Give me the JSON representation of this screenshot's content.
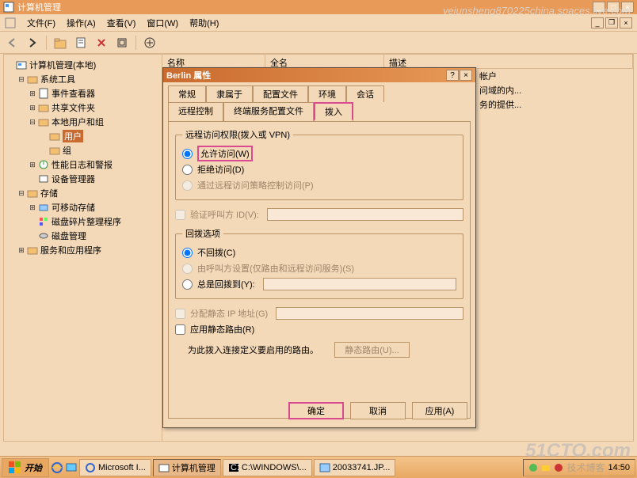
{
  "watermark1": "yejunsheng870225china.spaces.live.com",
  "watermark2": "51CTO.com",
  "watermark3": "技术博客",
  "window": {
    "title": "计算机管理"
  },
  "menu": {
    "file": "文件(F)",
    "action": "操作(A)",
    "view": "查看(V)",
    "window": "窗口(W)",
    "help": "帮助(H)"
  },
  "tree": {
    "root": "计算机管理(本地)",
    "system_tools": "系统工具",
    "event_viewer": "事件查看器",
    "shared_folders": "共享文件夹",
    "local_users": "本地用户和组",
    "users": "用户",
    "groups": "组",
    "perf": "性能日志和警报",
    "device_mgr": "设备管理器",
    "storage": "存储",
    "removable": "可移动存储",
    "defrag": "磁盘碎片整理程序",
    "disk_mgmt": "磁盘管理",
    "services": "服务和应用程序"
  },
  "list": {
    "col_name": "名称",
    "col_full": "全名",
    "col_desc": "描述",
    "row1_desc": "帐户",
    "row2_desc": "问域的内...",
    "row3_desc": "务的提供..."
  },
  "dialog": {
    "title": "Berlin 属性",
    "tabs": {
      "general": "常规",
      "member": "隶属于",
      "profiles": "配置文件",
      "env": "环境",
      "session": "会话",
      "remote": "远程控制",
      "terminal": "终端服务配置文件",
      "dialin": "拨入"
    },
    "remote_access": {
      "legend": "远程访问权限(拨入或 VPN)",
      "allow": "允许访问(W)",
      "deny": "拒绝访问(D)",
      "policy": "通过远程访问策略控制访问(P)"
    },
    "verify_caller": "验证呼叫方 ID(V):",
    "callback": {
      "legend": "回拨选项",
      "none": "不回拨(C)",
      "by_caller": "由呼叫方设置(仅路由和远程访问服务)(S)",
      "always": "总是回拨到(Y):"
    },
    "static_ip": "分配静态 IP 地址(G)",
    "static_routes": "应用静态路由(R)",
    "route_note": "为此拨入连接定义要启用的路由。",
    "route_btn": "静态路由(U)...",
    "ok": "确定",
    "cancel": "取消",
    "apply": "应用(A)"
  },
  "taskbar": {
    "start": "开始",
    "task1": "Microsoft I...",
    "task2": "计算机管理",
    "task3": "C:\\WINDOWS\\...",
    "task4": "20033741.JP...",
    "time": "14:50"
  }
}
